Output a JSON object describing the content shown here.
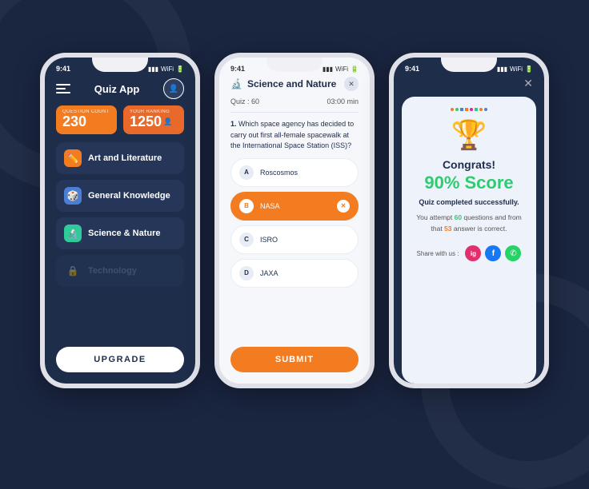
{
  "bg_color": "#1a2540",
  "phone1": {
    "status_time": "9:41",
    "title": "Quiz App",
    "stats": [
      {
        "label": "Question Count",
        "value": "230"
      },
      {
        "label": "Your Ranking",
        "value": "1250",
        "icon": "👤"
      }
    ],
    "categories": [
      {
        "id": "art",
        "icon": "✏️",
        "label": "Art and Literature",
        "icon_class": "art",
        "disabled": false
      },
      {
        "id": "gk",
        "icon": "🎲",
        "label": "General Knowledge",
        "icon_class": "gk",
        "disabled": false
      },
      {
        "id": "sci",
        "icon": "🔬",
        "label": "Science & Nature",
        "icon_class": "sci",
        "disabled": false
      },
      {
        "id": "tech",
        "icon": "🔒",
        "label": "Technology",
        "icon_class": "tech",
        "disabled": true
      }
    ],
    "upgrade_label": "UPGRADE"
  },
  "phone2": {
    "status_time": "9:41",
    "title": "Science and Nature",
    "quiz_count": "Quiz : 60",
    "quiz_time": "03:00 min",
    "question_num": "1.",
    "question_text": "Which space agency has decided to carry out first all-female spacewalk at the International Space Station (ISS)?",
    "options": [
      {
        "badge": "A",
        "label": "Roscosmos",
        "selected": false
      },
      {
        "badge": "B",
        "label": "NASA",
        "selected": true
      },
      {
        "badge": "C",
        "label": "ISRO",
        "selected": false
      },
      {
        "badge": "D",
        "label": "JAXA",
        "selected": false
      }
    ],
    "submit_label": "SUBMIT"
  },
  "phone3": {
    "status_time": "9:41",
    "congrats_label": "Congrats!",
    "score_label": "90% Score",
    "quiz_complete_label": "Quiz completed successfully.",
    "result_detail_prefix": "You attempt ",
    "result_questions": "60",
    "result_detail_middle": " questions and from that ",
    "result_answers": "53",
    "result_detail_suffix": " answer is correct.",
    "share_label": "Share with us :",
    "share_icons": [
      "ig",
      "fb",
      "wa"
    ]
  }
}
